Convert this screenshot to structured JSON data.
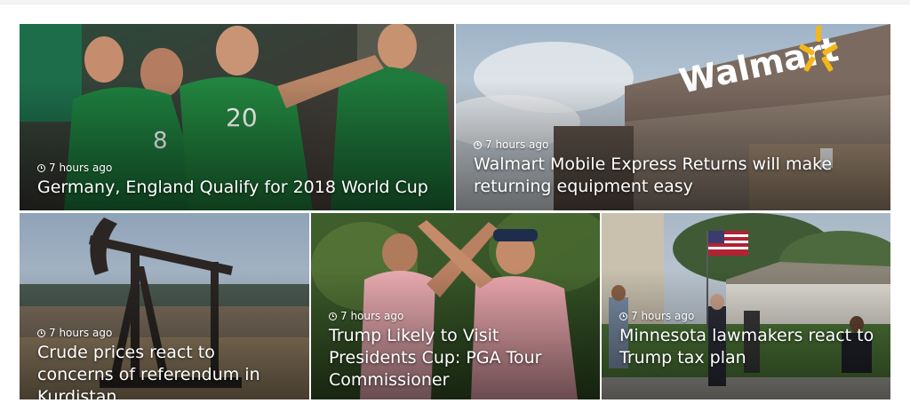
{
  "articles": [
    {
      "time": "7 hours ago",
      "title": "Germany, England Qualify for 2018 World Cup",
      "image": "soccer-players-celebrating"
    },
    {
      "time": "7 hours ago",
      "title": "Walmart Mobile Express Returns will make returning equipment easy",
      "image": "walmart-store-front",
      "sign_text": "Walmart"
    },
    {
      "time": "7 hours ago",
      "title": "Crude prices react to concerns of referendum in Kurdistan",
      "image": "oil-pumpjack-field"
    },
    {
      "time": "7 hours ago",
      "title": "Trump Likely to Visit Presidents Cup: PGA Tour Commissioner",
      "image": "golfers-high-five"
    },
    {
      "time": "7 hours ago",
      "title": "Minnesota lawmakers react to Trump tax plan",
      "image": "people-at-flag-event"
    }
  ],
  "icons": {
    "time": "clock-icon"
  },
  "colors": {
    "text": "#ffffff",
    "jersey_green": "#1e7f3e",
    "walmart_yellow": "#f4b619"
  }
}
